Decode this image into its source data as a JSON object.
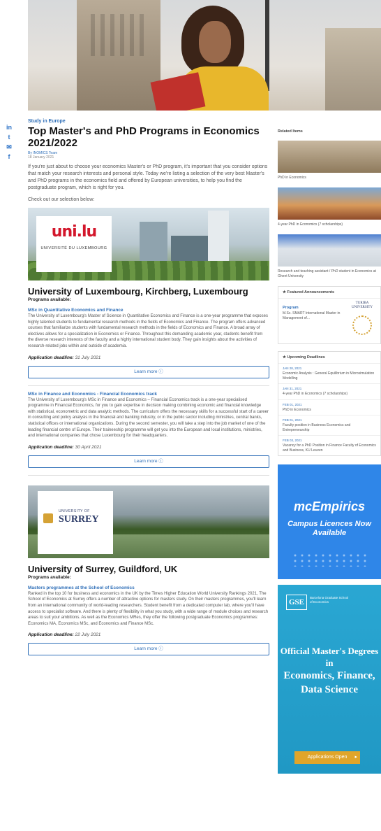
{
  "social": [
    "in",
    "t",
    "✉",
    "f"
  ],
  "article": {
    "kicker": "Study in Europe",
    "title": "Top Master's and PhD Programs in Economics 2021/2022",
    "byline": "By INOMICS Team",
    "date": "18 January 2021",
    "intro": "If you're just about to choose your economics Master's or PhD program, it's important that you consider options that match your research interests and personal style. Today we're listing a selection of the very best Master's and PhD programs in the economics field and offered by European universities, to help you find the postgraduate program, which is right for you.",
    "intro2": "Check out our selection below:"
  },
  "universities": [
    {
      "logo_main": "uni.lu",
      "logo_sub": "UNIVERSITÉ DU LUXEMBOURG",
      "title": "University of Luxembourg, Kirchberg, Luxembourg",
      "programs_label": "Programs available:",
      "programs": [
        {
          "name": "MSc in Quantitative Economics and Finance",
          "desc": "The University of Luxembourg's Master of Science in Quantitative Economics and Finance is a one-year programme that exposes highly talented students to fundamental research methods in the fields of Economics and Finance. The program offers advanced courses that familiarize students with fundamental research methods in the fields of Economics and Finance. A broad array of electives allows for a specialization in Economics or Finance. Throughout this demanding academic year, students benefit from the diverse research interests of the faculty and a highly international student body. They gain insights about the activities of research-related jobs within and outside of academia.",
          "deadline_label": "Application deadline:",
          "deadline": "31 July 2021",
          "button": "Learn more ⓘ"
        },
        {
          "name": "MSc in Finance and Economics - Financial Economics track",
          "desc": "The University of Luxembourg's MSc in Finance and Economics – Financial Economics track is a one-year specialised programme in Financial Economics, for you to gain expertise in decision making combining economic and financial knowledge with statistical, econometric and data analytic methods. The curriculum offers the necessary skills for a successful start of a career in consulting and policy analysis in the financial and banking industry, or in the public sector including ministries, central banks, statistical offices or international organizations. During the second semester, you will take a step into the job market of one of the leading financial centre of Europe. Their traineeship programme will get you into the European and local institutions, ministries, and international companies that chose Luxembourg for their headquarters.",
          "deadline_label": "Application deadline:",
          "deadline": "30 April 2021",
          "button": "Learn more ⓘ"
        }
      ]
    },
    {
      "logo_main": "SURREY",
      "logo_sub": "UNIVERSITY OF",
      "title": "University of Surrey, Guildford, UK",
      "programs_label": "Programs available:",
      "programs": [
        {
          "name": "Masters programmes at the School of Economics",
          "desc": "Ranked in the top 10 for business and economics in the UK by the Times Higher Education World University Rankings 2021, The School of Economics at Surrey offers a number of attractive options for masters study. On their masters programmes, you'll learn from an international community of world-leading researchers. Student benefit from a dedicated computer lab, where you'll have access to specialist software. And there is plenty of flexibility in what you study, with a wide range of module choices and research areas to suit your ambitions. As well as the Economics MRes, they offer the following postgraduate Economics programmes: Economics MA, Economics MSc, and Economics and Finance MSc.",
          "deadline_label": "Application deadline:",
          "deadline": "22 July 2021",
          "button": "Learn more ⓘ"
        }
      ]
    }
  ],
  "sidebar": {
    "related_head": "Related Items",
    "related": [
      {
        "caption": "PhD in Economics"
      },
      {
        "caption": "4-year PhD in Economics (7 scholarships)"
      },
      {
        "caption": "Research and teaching assistant / PhD student in Economics at Ghent University"
      }
    ],
    "featured_head": "★ Featured Announcements",
    "featured": {
      "label": "Program",
      "text": "M.Sc. SMART International Master in Management of...",
      "logo": "TURIBA UNIVERSITY"
    },
    "deadlines_head": "★ Upcoming Deadlines",
    "deadlines": [
      {
        "date": "JAN 28, 2021",
        "title": "Economic Analysis : General Equilibrium in Microsimulation Modelling"
      },
      {
        "date": "JAN 31, 2021",
        "title": "4-year PhD in Economics (7 scholarships)"
      },
      {
        "date": "FEB 01, 2021",
        "title": "PhD in Economics"
      },
      {
        "date": "FEB 01, 2021",
        "title": "Faculty position in Business Economics and Entrepreneurship"
      },
      {
        "date": "FEB 03, 2021",
        "title": "Vacancy for a PhD Position in Finance Faculty of Economics and Business, KU Leuven"
      }
    ],
    "ad1": {
      "title": "mcEmpirics",
      "subtitle": "Campus Licences Now Available",
      "color": "#2f86e8"
    },
    "ad2": {
      "logo": "GSE",
      "logo_text": "Barcelona Graduate School of Economics",
      "line1": "Official Master's Degrees in",
      "line2": "Economics, Finance, Data Science",
      "cta": "Applications Open"
    }
  }
}
